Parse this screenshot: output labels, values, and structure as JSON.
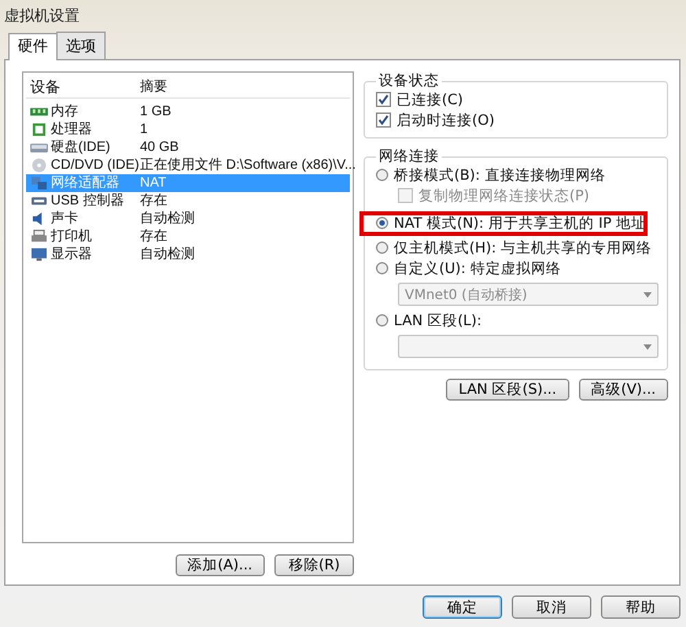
{
  "window": {
    "title": "虚拟机设置"
  },
  "tabs": [
    {
      "label": "硬件",
      "selected": true
    },
    {
      "label": "选项",
      "selected": false
    }
  ],
  "device_list": {
    "columns": [
      "设备",
      "摘要"
    ],
    "rows": [
      {
        "kind": "memory",
        "device": "内存",
        "summary": "1 GB",
        "selected": false
      },
      {
        "kind": "cpu",
        "device": "处理器",
        "summary": "1",
        "selected": false
      },
      {
        "kind": "disk",
        "device": "硬盘(IDE)",
        "summary": "40 GB",
        "selected": false
      },
      {
        "kind": "cd",
        "device": "CD/DVD (IDE)",
        "summary": "正在使用文件 D:\\Software (x86)\\V...",
        "selected": false
      },
      {
        "kind": "network",
        "device": "网络适配器",
        "summary": "NAT",
        "selected": true
      },
      {
        "kind": "usb",
        "device": "USB 控制器",
        "summary": "存在",
        "selected": false
      },
      {
        "kind": "sound",
        "device": "声卡",
        "summary": "自动检测",
        "selected": false
      },
      {
        "kind": "printer",
        "device": "打印机",
        "summary": "存在",
        "selected": false
      },
      {
        "kind": "display",
        "device": "显示器",
        "summary": "自动检测",
        "selected": false
      }
    ]
  },
  "list_buttons": [
    "添加(A)...",
    "移除(R)"
  ],
  "device_status": {
    "title": "设备状态",
    "options": [
      {
        "label": "已连接(C)",
        "checked": true
      },
      {
        "label": "启动时连接(O)",
        "checked": true
      }
    ]
  },
  "network": {
    "title": "网络连接",
    "options": [
      {
        "kind": "radio",
        "label": "桥接模式(B): 直接连接物理网络",
        "selected": false,
        "highlighted": false
      },
      {
        "kind": "checkbox",
        "label": "复制物理网络连接状态(P)",
        "checked": false,
        "disabled": true
      },
      {
        "kind": "radio",
        "label": "NAT 模式(N): 用于共享主机的 IP 地址",
        "selected": true,
        "highlighted": true
      },
      {
        "kind": "radio",
        "label": "仅主机模式(H): 与主机共享的专用网络",
        "selected": false,
        "highlighted": false
      },
      {
        "kind": "radio",
        "label": "自定义(U): 特定虚拟网络",
        "selected": false,
        "highlighted": false
      },
      {
        "kind": "select",
        "value": "VMnet0 (自动桥接)",
        "disabled": true
      },
      {
        "kind": "radio",
        "label": "LAN 区段(L):",
        "selected": false,
        "highlighted": false
      },
      {
        "kind": "select",
        "disabled": true
      }
    ]
  },
  "network_buttons": [
    "LAN 区段(S)...",
    "高级(V)..."
  ],
  "dialog_buttons": [
    {
      "label": "确定",
      "default": true
    },
    {
      "label": "取消",
      "default": false
    },
    {
      "label": "帮助",
      "default": false
    }
  ]
}
